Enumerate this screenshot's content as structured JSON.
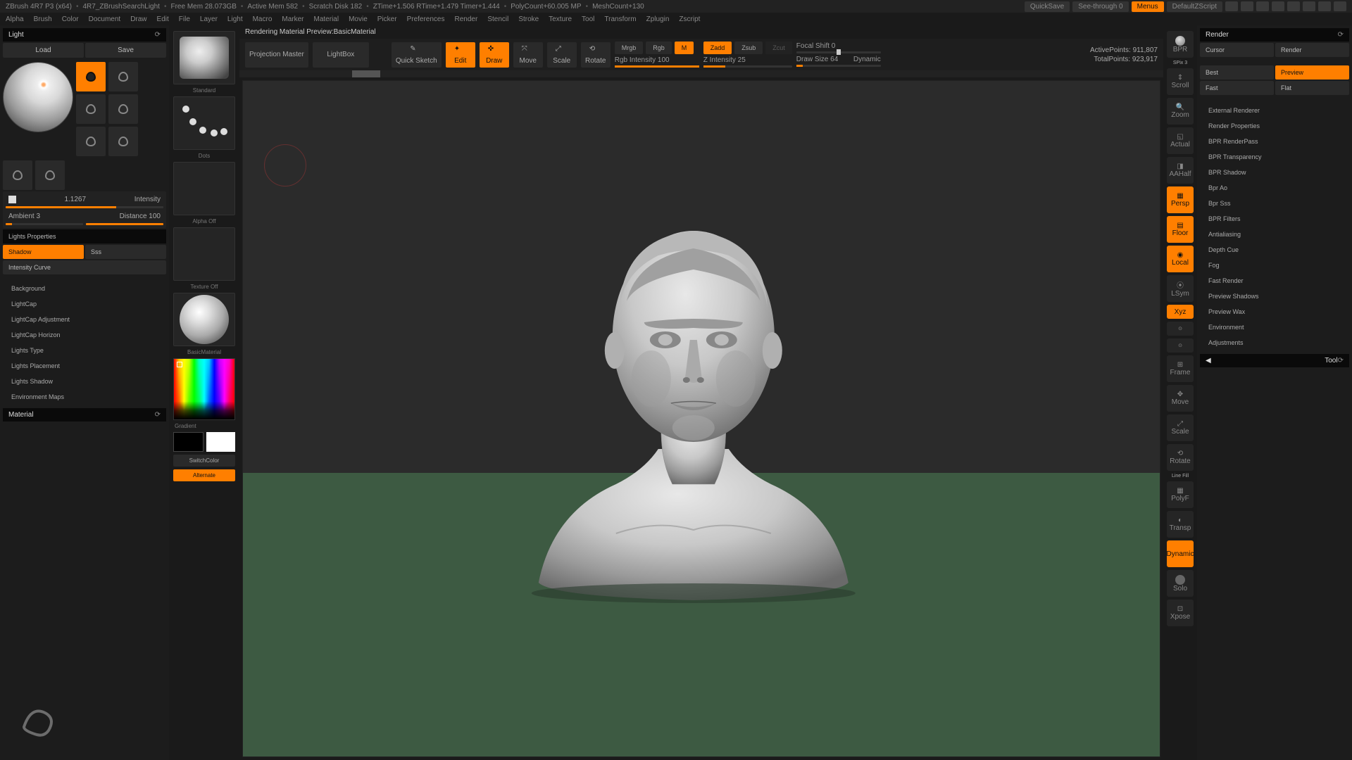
{
  "title": {
    "app": "ZBrush 4R7 P3 (x64)",
    "proj": "4R7_ZBrushSearchLight",
    "freeMem": "Free Mem 28.073GB",
    "activeMem": "Active Mem 582",
    "scratch": "Scratch Disk 182",
    "ztime": "ZTime+1.506 RTime+1.479 Timer+1.444",
    "poly": "PolyCount+60.005 MP",
    "mesh": "MeshCount+130",
    "quicksave": "QuickSave",
    "seethrough": "See-through  0",
    "menus": "Menus",
    "doc": "DefaultZScript"
  },
  "menu": [
    "Alpha",
    "Brush",
    "Color",
    "Document",
    "Draw",
    "Edit",
    "File",
    "Layer",
    "Light",
    "Macro",
    "Marker",
    "Material",
    "Movie",
    "Picker",
    "Preferences",
    "Render",
    "Stencil",
    "Stroke",
    "Texture",
    "Tool",
    "Transform",
    "Zplugin",
    "Zscript"
  ],
  "left": {
    "light": "Light",
    "load": "Load",
    "save": "Save",
    "intensity_val": "1.1267",
    "intensity_lbl": "Intensity",
    "ambient": "Ambient 3",
    "distance": "Distance 100",
    "props": "Lights Properties",
    "shadow": "Shadow",
    "sss": "Sss",
    "curve": "Intensity Curve",
    "items": [
      "Background",
      "LightCap",
      "LightCap Adjustment",
      "LightCap Horizon",
      "Lights Type",
      "Lights Placement",
      "Lights Shadow",
      "Environment Maps"
    ],
    "material": "Material"
  },
  "tray": {
    "standard": "Standard",
    "dots": "Dots",
    "alphaOff": "Alpha Off",
    "textureOff": "Texture Off",
    "basicMat": "BasicMaterial",
    "gradient": "Gradient",
    "switchcolor": "SwitchColor",
    "alternate": "Alternate"
  },
  "center": {
    "title": "Rendering Material Preview:BasicMaterial",
    "projection": "Projection Master",
    "lightbox": "LightBox",
    "quicksketch": "Quick Sketch",
    "edit": "Edit",
    "draw": "Draw",
    "move": "Move",
    "scale": "Scale",
    "rotate": "Rotate",
    "mrgb": "Mrgb",
    "rgb": "Rgb",
    "m": "M",
    "zadd": "Zadd",
    "zsub": "Zsub",
    "zcut": "Zcut",
    "rgbInt": "Rgb Intensity 100",
    "zInt": "Z Intensity 25",
    "focal": "Focal Shift 0",
    "drawSize": "Draw Size 64",
    "dynamic": "Dynamic",
    "active": "ActivePoints: 911,807",
    "total": "TotalPoints: 923,917"
  },
  "rstrip": {
    "bpr": "BPR",
    "spix": "SPix 3",
    "scroll": "Scroll",
    "zoom": "Zoom",
    "actual": "Actual",
    "aahalf": "AAHalf",
    "persp": "Persp",
    "floor": "Floor",
    "local": "Local",
    "lsym": "LSym",
    "xyz": "Xyz",
    "frame": "Frame",
    "move": "Move",
    "scale": "Scale",
    "rotate": "Rotate",
    "linefill": "Line Fill",
    "polyf": "PolyF",
    "transp": "Transp",
    "dynamic": "Dynamic",
    "solo": "Solo",
    "xpose": "Xpose"
  },
  "right": {
    "render": "Render",
    "cursor": "Cursor",
    "renderBtn": "Render",
    "best": "Best",
    "preview": "Preview",
    "fast": "Fast",
    "flat": "Flat",
    "items": [
      "External Renderer",
      "Render Properties",
      "BPR RenderPass",
      "BPR Transparency",
      "BPR Shadow",
      "Bpr Ao",
      "Bpr Sss",
      "BPR Filters",
      "Antialiasing",
      "Depth Cue",
      "Fog",
      "Fast Render",
      "Preview Shadows",
      "Preview Wax",
      "Environment",
      "Adjustments"
    ],
    "tool": "Tool"
  }
}
